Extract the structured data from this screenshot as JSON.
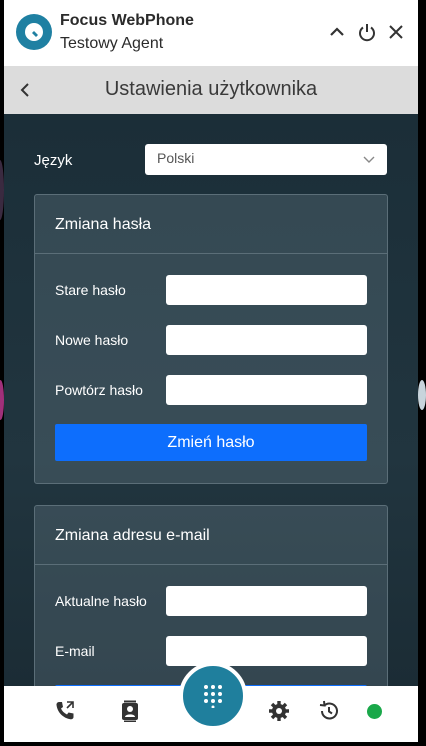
{
  "app": {
    "name": "Focus WebPhone",
    "agent": "Testowy Agent"
  },
  "header": {
    "title": "Ustawienia użytkownika"
  },
  "language": {
    "label": "Język",
    "selected": "Polski"
  },
  "password_section": {
    "title": "Zmiana hasła",
    "old_password_label": "Stare hasło",
    "new_password_label": "Nowe hasło",
    "repeat_password_label": "Powtórz hasło",
    "submit_label": "Zmień hasło"
  },
  "email_section": {
    "title": "Zmiana adresu e-mail",
    "current_password_label": "Aktualne hasło",
    "email_label": "E-mail"
  },
  "bottom_bar": {
    "icons": [
      "phone-history-icon",
      "contacts-icon",
      "dialpad-icon",
      "settings-icon",
      "history-icon"
    ],
    "status": "online"
  },
  "colors": {
    "accent": "#1f7f9d",
    "primary_button": "#0d6efd",
    "status_online": "#1aa84a",
    "header_bg": "#dcdcdc",
    "content_bg": "#1e323c"
  }
}
